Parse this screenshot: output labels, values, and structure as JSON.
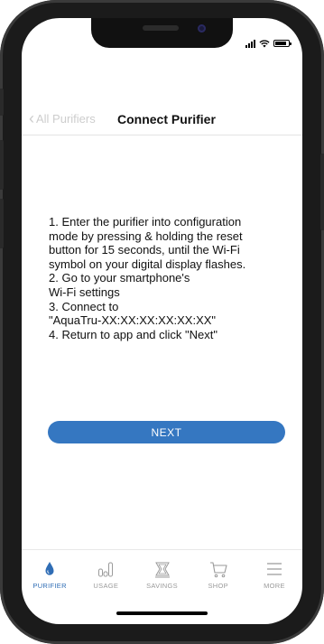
{
  "nav": {
    "back_label": "All Purifiers",
    "title": "Connect Purifier"
  },
  "instructions": [
    "1. Enter the purifier into configuration",
    "mode by pressing & holding the reset",
    "button for 15 seconds, until the Wi-Fi",
    "symbol on your digital display flashes.",
    "2. Go to your smartphone's",
    "Wi-Fi settings",
    "3. Connect to",
    "\"AquaTru-XX:XX:XX:XX:XX:XX\"",
    "4. Return to app and click \"Next\""
  ],
  "next_button": {
    "label": "NEXT"
  },
  "tabs": [
    {
      "label": "PURIFIER",
      "icon": "water-drop-icon",
      "active": true
    },
    {
      "label": "USAGE",
      "icon": "bar-chart-icon",
      "active": false
    },
    {
      "label": "SAVINGS",
      "icon": "piggy-bank-icon",
      "active": false
    },
    {
      "label": "SHOP",
      "icon": "cart-icon",
      "active": false
    },
    {
      "label": "MORE",
      "icon": "menu-icon",
      "active": false
    }
  ],
  "colors": {
    "accent": "#3577c1",
    "active_tab": "#2f6db5",
    "inactive_tab": "#9a9a9a",
    "back_link": "#cdcdcd"
  }
}
